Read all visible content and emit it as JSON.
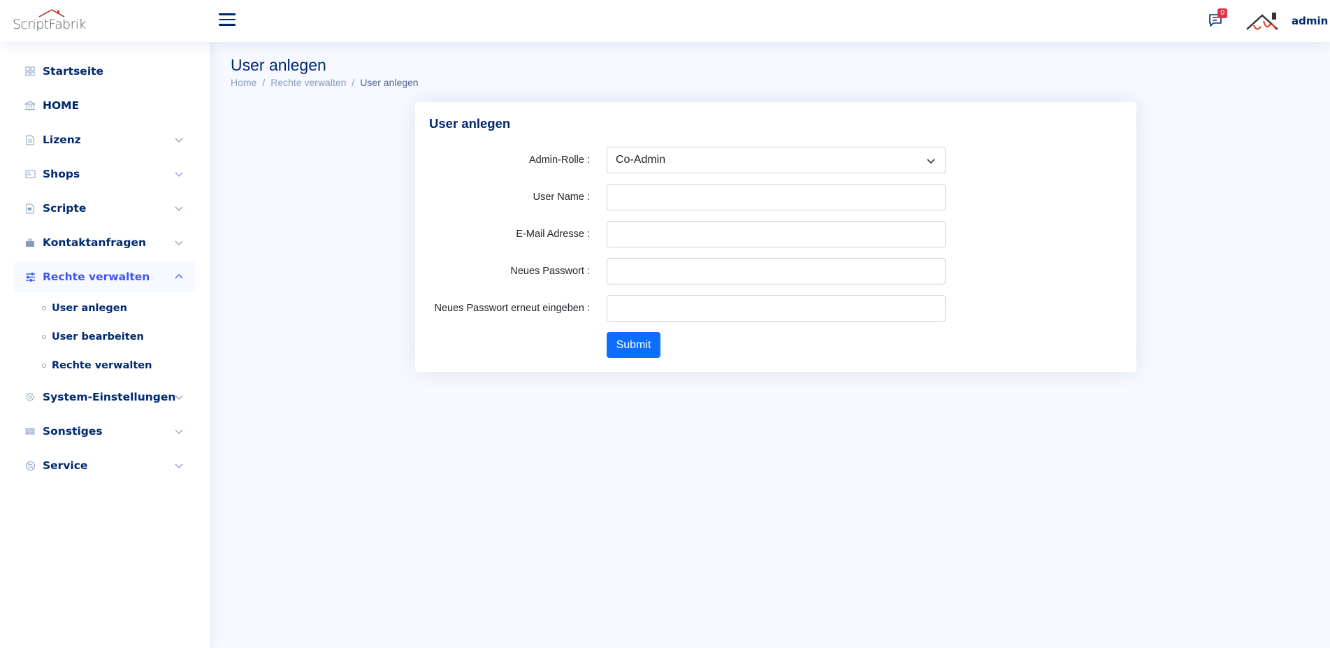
{
  "header": {
    "logo_text": "ScriptFabrik",
    "notifications_count": "0",
    "user_name": "admin"
  },
  "sidebar": {
    "items": [
      {
        "label": "Startseite",
        "icon": "grid-icon",
        "has_children": false
      },
      {
        "label": "HOME",
        "icon": "bank-icon",
        "has_children": false
      },
      {
        "label": "Lizenz",
        "icon": "document-icon",
        "has_children": true
      },
      {
        "label": "Shops",
        "icon": "card-icon",
        "has_children": true
      },
      {
        "label": "Scripte",
        "icon": "file-icon",
        "has_children": true
      },
      {
        "label": "Kontaktanfragen",
        "icon": "briefcase-icon",
        "has_children": true
      },
      {
        "label": "Rechte verwalten",
        "icon": "sliders-icon",
        "has_children": true,
        "active": true
      },
      {
        "label": "System-Einstellungen",
        "icon": "gear-icon",
        "has_children": true
      },
      {
        "label": "Sonstiges",
        "icon": "apps-icon",
        "has_children": true
      },
      {
        "label": "Service",
        "icon": "service-icon",
        "has_children": true
      }
    ],
    "sub_items": [
      {
        "label": "User anlegen"
      },
      {
        "label": "User bearbeiten"
      },
      {
        "label": "Rechte verwalten"
      }
    ]
  },
  "main": {
    "page_title": "User anlegen",
    "breadcrumb": [
      "Home",
      "Rechte verwalten",
      "User anlegen"
    ],
    "card_title": "User anlegen",
    "form": {
      "admin_role_label": "Admin-Rolle :",
      "admin_role_value": "Co-Admin",
      "user_name_label": "User Name :",
      "user_name_value": "",
      "email_label": "E-Mail Adresse :",
      "email_value": "",
      "password_label": "Neues Passwort :",
      "password_value": "",
      "password_repeat_label": "Neues Passwort erneut eingeben :",
      "password_repeat_value": "",
      "submit_label": "Submit"
    }
  },
  "colors": {
    "primary": "#012970",
    "accent": "#4154f1",
    "button": "#0d6efd",
    "badge": "#dc3545"
  }
}
